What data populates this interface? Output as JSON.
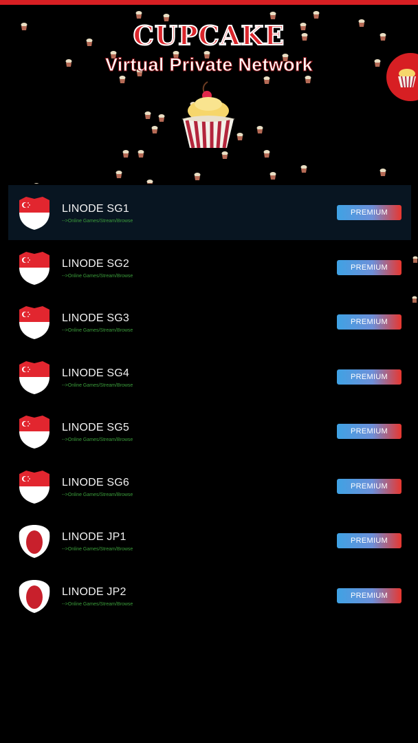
{
  "header": {
    "title": "CUPCAKE",
    "subtitle": "Virtual Private Network"
  },
  "servers": [
    {
      "name": "LINODE SG1",
      "description": "-->Online Games/Stream/Browse",
      "badge": "PREMIUM",
      "flag": "singapore-flag-icon",
      "selected": true
    },
    {
      "name": "LINODE SG2",
      "description": "-->Online Games/Stream/Browse",
      "badge": "PREMIUM",
      "flag": "singapore-flag-icon",
      "selected": false
    },
    {
      "name": "LINODE SG3",
      "description": "-->Online Games/Stream/Browse",
      "badge": "PREMIUM",
      "flag": "singapore-flag-icon",
      "selected": false
    },
    {
      "name": "LINODE SG4",
      "description": "-->Online Games/Stream/Browse",
      "badge": "PREMIUM",
      "flag": "singapore-flag-icon",
      "selected": false
    },
    {
      "name": "LINODE SG5",
      "description": "-->Online Games/Stream/Browse",
      "badge": "PREMIUM",
      "flag": "singapore-flag-icon",
      "selected": false
    },
    {
      "name": "LINODE SG6",
      "description": "-->Online Games/Stream/Browse",
      "badge": "PREMIUM",
      "flag": "singapore-flag-icon",
      "selected": false
    },
    {
      "name": "LINODE JP1",
      "description": "-->Online Games/Stream/Browse",
      "badge": "PREMIUM",
      "flag": "japan-flag-icon",
      "selected": false
    },
    {
      "name": "LINODE JP2",
      "description": "-->Online Games/Stream/Browse",
      "badge": "PREMIUM",
      "flag": "japan-flag-icon",
      "selected": false
    }
  ],
  "colors": {
    "accent_red": "#d71f23",
    "selected_row": "#081521",
    "description_green": "#3b9d3b",
    "premium_gradient": [
      "#3fa2e4",
      "#e8372f"
    ]
  }
}
